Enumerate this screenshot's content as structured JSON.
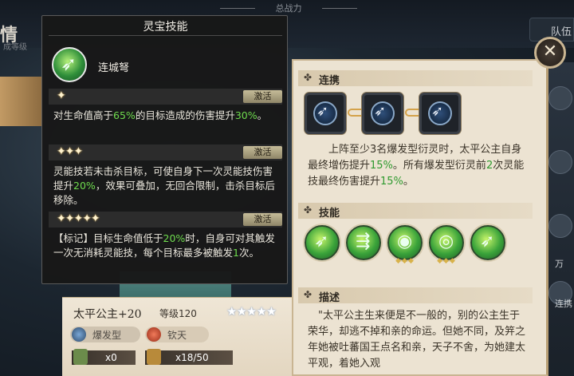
{
  "background": {
    "top_label": "总战力",
    "left_glyph": "情",
    "left_sub": "成等级",
    "team_button": "队伍",
    "right_label_1": "万",
    "right_label_2": "连携"
  },
  "tooltip": {
    "title": "灵宝技能",
    "skill_name": "连城弩",
    "tiers": [
      {
        "stars": "✦",
        "badge": "激活",
        "parts": [
          "对生命值高于",
          "65%",
          "的目标造成的伤害提升",
          "30%",
          "。"
        ]
      },
      {
        "stars": "✦✦✦",
        "badge": "激活",
        "parts": [
          "灵能技若未击杀目标，可使自身下一次灵能技伤害提升",
          "20%",
          "，效果可叠加，无回合限制，击杀目标后移除。"
        ]
      },
      {
        "stars": "✦✦✦✦✦",
        "badge": "激活",
        "parts": [
          "【标记】目标生命值低于",
          "20%",
          "时，自身可对其触发一次无消耗灵能技，每个目标最多被触发",
          "1",
          "次。"
        ]
      }
    ]
  },
  "detail": {
    "chain": {
      "title": "连携",
      "icon": "clover-icon",
      "desc_parts": [
        "上阵至少3名爆发型衍灵时，太平公主自身最终增伤提升",
        "15%",
        "。所有爆发型衍灵前",
        "2",
        "次灵能技最终伤害提升",
        "15%",
        "。"
      ]
    },
    "skills": {
      "title": "技能",
      "icon": "clover-icon"
    },
    "bio": {
      "title": "描述",
      "icon": "clover-icon",
      "text": "\"太平公主生来便是不一般的，别的公主生于荣华，却逃不掉和亲的命运。但她不同，及笄之年她被吐蕃国王点名和亲，天子不舍，为她建太平观，着她入观"
    }
  },
  "character": {
    "name": "太平公主+20",
    "level": "等级120",
    "stars": "★★★★★",
    "type_tag": "爆发型",
    "faction_tag": "钦天",
    "stat_a": "x0",
    "stat_b": "x18/50"
  },
  "colors": {
    "highlight_green": "#2f9a2f",
    "tooltip_highlight": "#6fdc4e",
    "panel_bg": "#ece3d2"
  }
}
